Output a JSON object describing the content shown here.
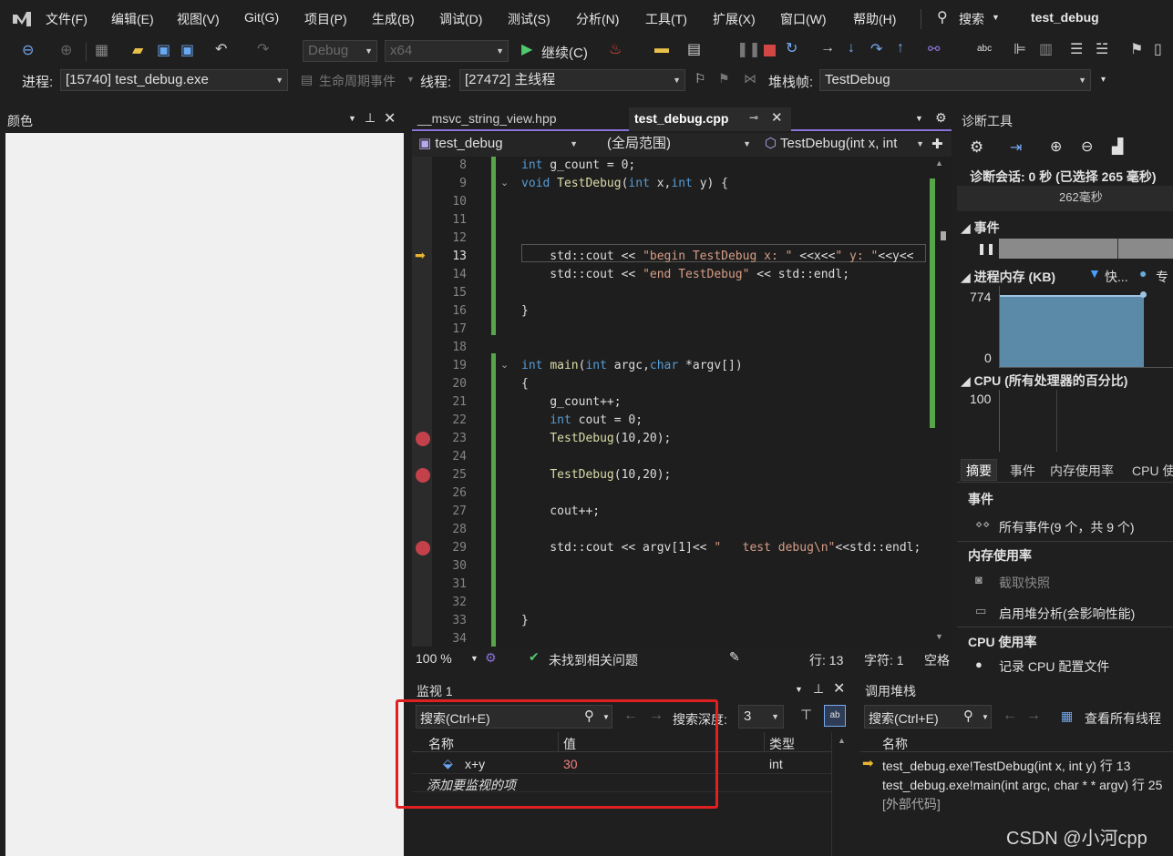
{
  "menu": {
    "items": [
      "文件(F)",
      "编辑(E)",
      "视图(V)",
      "Git(G)",
      "项目(P)",
      "生成(B)",
      "调试(D)",
      "测试(S)",
      "分析(N)",
      "工具(T)",
      "扩展(X)",
      "窗口(W)",
      "帮助(H)"
    ],
    "search": "搜索",
    "solution": "test_debug"
  },
  "toolbar": {
    "config": "Debug",
    "platform": "x64",
    "continue": "继续(C)"
  },
  "debugbar": {
    "process_label": "进程:",
    "process_value": "[15740] test_debug.exe",
    "lifecycle": "生命周期事件",
    "thread_label": "线程:",
    "thread_value": "[27472] 主线程",
    "stack_label": "堆栈帧:",
    "stack_value": "TestDebug"
  },
  "colors_panel": {
    "title": "颜色"
  },
  "editor": {
    "tabs": [
      "__msvc_string_view.hpp",
      "test_debug.cpp"
    ],
    "nav": {
      "project": "test_debug",
      "scope": "(全局范围)",
      "member": "TestDebug(int x, int"
    },
    "lines": [
      {
        "n": "8",
        "html": "<span class='kw'>int</span><span class='tx'> g_count = 0;</span>"
      },
      {
        "n": "9",
        "html": "<span class='kw'>void</span><span class='tx'> </span><span class='fn'>TestDebug</span><span class='tx'>(</span><span class='kw'>int</span><span class='tx'> x,</span><span class='kw'>int</span><span class='tx'> y) {</span>"
      },
      {
        "n": "10",
        "html": ""
      },
      {
        "n": "11",
        "html": ""
      },
      {
        "n": "12",
        "html": ""
      },
      {
        "n": "13",
        "html": "<span class='tx'>    std::cout &lt;&lt; </span><span class='st'>\"begin TestDebug x: \"</span><span class='tx'> &lt;&lt;x&lt;&lt;</span><span class='st'>\" y: \"</span><span class='tx'>&lt;&lt;y&lt;&lt;</span>"
      },
      {
        "n": "14",
        "html": "<span class='tx'>    std::cout &lt;&lt; </span><span class='st'>\"end TestDebug\"</span><span class='tx'> &lt;&lt; std::endl;</span>"
      },
      {
        "n": "15",
        "html": ""
      },
      {
        "n": "16",
        "html": "<span class='tx'>}</span>"
      },
      {
        "n": "17",
        "html": ""
      },
      {
        "n": "18",
        "html": ""
      },
      {
        "n": "19",
        "html": "<span class='kw'>int</span><span class='tx'> </span><span class='fn'>main</span><span class='tx'>(</span><span class='kw'>int</span><span class='tx'> argc,</span><span class='kw'>char</span><span class='tx'> *argv[])</span>"
      },
      {
        "n": "20",
        "html": "<span class='tx'>{</span>"
      },
      {
        "n": "21",
        "html": "<span class='tx'>    g_count++;</span>"
      },
      {
        "n": "22",
        "html": "<span class='tx'>    </span><span class='kw'>int</span><span class='tx'> cout = 0;</span>"
      },
      {
        "n": "23",
        "html": "<span class='tx'>    </span><span class='fn'>TestDebug</span><span class='tx'>(10,20);</span>"
      },
      {
        "n": "24",
        "html": ""
      },
      {
        "n": "25",
        "html": "<span class='tx'>    </span><span class='fn'>TestDebug</span><span class='tx'>(10,20);</span>"
      },
      {
        "n": "26",
        "html": ""
      },
      {
        "n": "27",
        "html": "<span class='tx'>    cout++;</span>"
      },
      {
        "n": "28",
        "html": ""
      },
      {
        "n": "29",
        "html": "<span class='tx'>    std::cout &lt;&lt; argv[1]&lt;&lt; </span><span class='st'>\"   test debug\\n\"</span><span class='tx'>&lt;&lt;std::endl;</span>"
      },
      {
        "n": "30",
        "html": ""
      },
      {
        "n": "31",
        "html": ""
      },
      {
        "n": "32",
        "html": ""
      },
      {
        "n": "33",
        "html": "<span class='tx'>}</span>"
      },
      {
        "n": "34",
        "html": ""
      }
    ],
    "status": {
      "zoom": "100 %",
      "issues": "未找到相关问题",
      "line": "行: 13",
      "char": "字符: 1",
      "space": "空格"
    }
  },
  "diag": {
    "title": "诊断工具",
    "session": "诊断会话: 0 秒 (已选择 265 毫秒)",
    "ruler": "262毫秒",
    "events": "事件",
    "memory": "进程内存 (KB)",
    "legend1": "快...",
    "legend2": "专",
    "mem_max": "774",
    "mem_min": "0",
    "cpu": "CPU (所有处理器的百分比)",
    "cpu_max": "100",
    "tabs": [
      "摘要",
      "事件",
      "内存使用率",
      "CPU 使"
    ],
    "sec_events": "事件",
    "all_events": "所有事件(9 个，共 9 个)",
    "sec_mem": "内存使用率",
    "snapshot": "截取快照",
    "heap": "启用堆分析(会影响性能)",
    "sec_cpu": "CPU 使用率",
    "cpu_record": "记录 CPU 配置文件"
  },
  "watch": {
    "title": "监视 1",
    "search": "搜索(Ctrl+E)",
    "depth_label": "搜索深度:",
    "depth": "3",
    "col_name": "名称",
    "col_value": "值",
    "col_type": "类型",
    "rows": [
      {
        "name": "x+y",
        "value": "30",
        "type": "int"
      }
    ],
    "add": "添加要监视的项"
  },
  "callstack": {
    "title": "调用堆栈",
    "search": "搜索(Ctrl+E)",
    "viewall": "查看所有线程",
    "col_name": "名称",
    "rows": [
      "test_debug.exe!TestDebug(int x, int y) 行 13",
      "test_debug.exe!main(int argc, char * * argv) 行 25",
      "[外部代码]"
    ]
  },
  "watermark": "CSDN @小河cpp",
  "colors": {
    "accent": "#8a72d8",
    "breakpoint": "#c3414b",
    "highlight": "#e02020"
  }
}
